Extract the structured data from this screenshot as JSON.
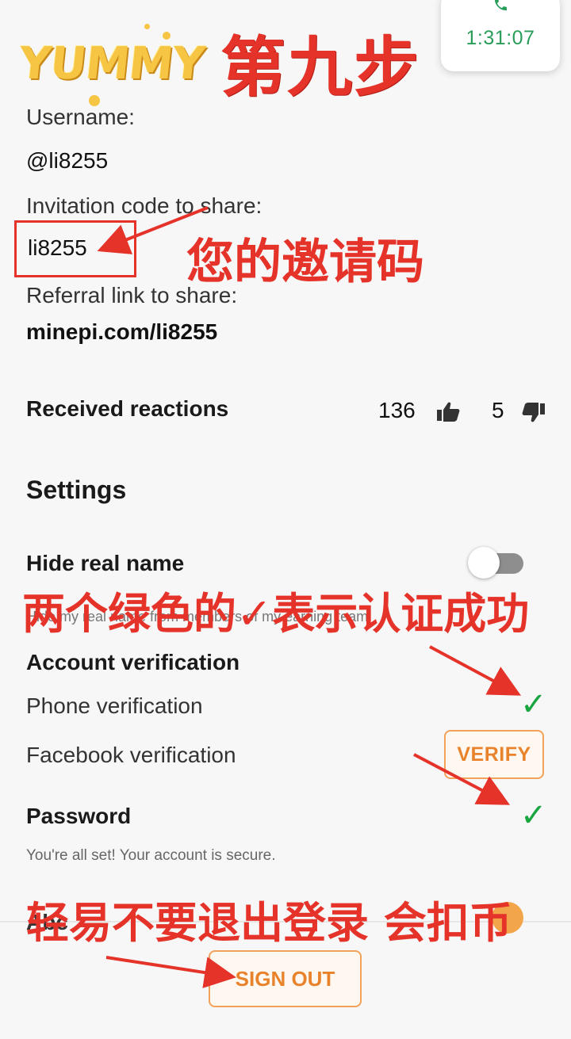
{
  "header": {
    "call_time": "1:31:07",
    "logo_text": "YUMMY",
    "step_title": "第九步"
  },
  "profile": {
    "username_label": "Username:",
    "username_value": "@li8255",
    "invitation_label": "Invitation code to share:",
    "invitation_value": "li8255",
    "referral_label": "Referral link to share:",
    "referral_value": "minepi.com/li8255"
  },
  "reactions": {
    "label": "Received reactions",
    "likes": "136",
    "dislikes": "5"
  },
  "settings": {
    "title": "Settings",
    "hide_real_name_label": "Hide real name",
    "hide_real_name_desc": "Hide my real name from members of my earning team",
    "account_verification_title": "Account verification",
    "phone_verification_label": "Phone verification",
    "facebook_verification_label": "Facebook verification",
    "verify_button": "VERIFY",
    "password_title": "Password",
    "password_desc": "You're all set! Your account is secure.",
    "check_glyph": "✓"
  },
  "footer": {
    "partial_heading": "Abc",
    "sign_out_button": "SIGN OUT"
  },
  "annotations": {
    "invite_code_note": "您的邀请码",
    "verification_note": "两个绿色的✓表示认证成功",
    "signout_note": "轻易不要退出登录  会扣币"
  },
  "colors": {
    "annotation_red": "#e5332a",
    "check_green": "#19a53f",
    "button_orange": "#e8832c",
    "timer_green": "#2a9d5b"
  }
}
